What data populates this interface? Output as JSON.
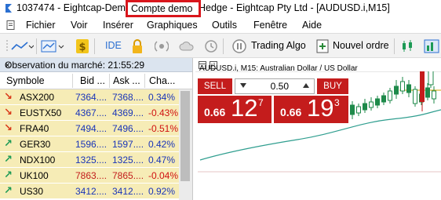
{
  "titlebar": {
    "left_text": "1037474 - Eightcap-Dem",
    "highlight_text": "Compte demo",
    "right_text": "Hedge - Eightcap Pty Ltd - [AUDUSD.i,M15]"
  },
  "menu": {
    "items": [
      "Fichier",
      "Voir",
      "Insérer",
      "Graphiques",
      "Outils",
      "Fenêtre",
      "Aide"
    ]
  },
  "toolbar": {
    "ide_label": "IDE",
    "algo_label": "Trading Algo",
    "new_order_label": "Nouvel ordre"
  },
  "market_watch": {
    "title": "Observation du marché: 21:55:29",
    "close_glyph": "×",
    "columns": [
      "Symbole",
      "Bid ...",
      "Ask ...",
      "Cha..."
    ],
    "rows": [
      {
        "dir": "down",
        "symbol": "ASX200",
        "bid": "7364....",
        "ask": "7368....",
        "change": "0.34%"
      },
      {
        "dir": "down",
        "symbol": "EUSTX50",
        "bid": "4367....",
        "ask": "4369....",
        "change": "-0.43%"
      },
      {
        "dir": "down",
        "symbol": "FRA40",
        "bid": "7494....",
        "ask": "7496....",
        "change": "-0.51%"
      },
      {
        "dir": "up",
        "symbol": "GER30",
        "bid": "1596....",
        "ask": "1597....",
        "change": "0.42%"
      },
      {
        "dir": "up",
        "symbol": "NDX100",
        "bid": "1325....",
        "ask": "1325....",
        "change": "0.47%"
      },
      {
        "dir": "up",
        "symbol": "UK100",
        "bid": "7863....",
        "ask": "7865....",
        "change": "-0.04%"
      },
      {
        "dir": "up",
        "symbol": "US30",
        "bid": "3412....",
        "ask": "3412....",
        "change": "0.92%"
      }
    ]
  },
  "chart": {
    "tab_label": "AUDUSD.i,M15",
    "title": "AUDUSD.i, M15:  Australian Dollar / US Dollar",
    "sell_label": "SELL",
    "buy_label": "BUY",
    "lot": "0.50",
    "sell_small": "0.66",
    "sell_big": "12",
    "sell_sup": "7",
    "buy_small": "0.66",
    "buy_big": "19",
    "buy_sup": "3"
  },
  "colors": {
    "accent_red": "#c41c1c",
    "highlight_border": "#d9161c",
    "row_yellow": "#f6ecb6",
    "value_blue": "#1a35b8"
  }
}
